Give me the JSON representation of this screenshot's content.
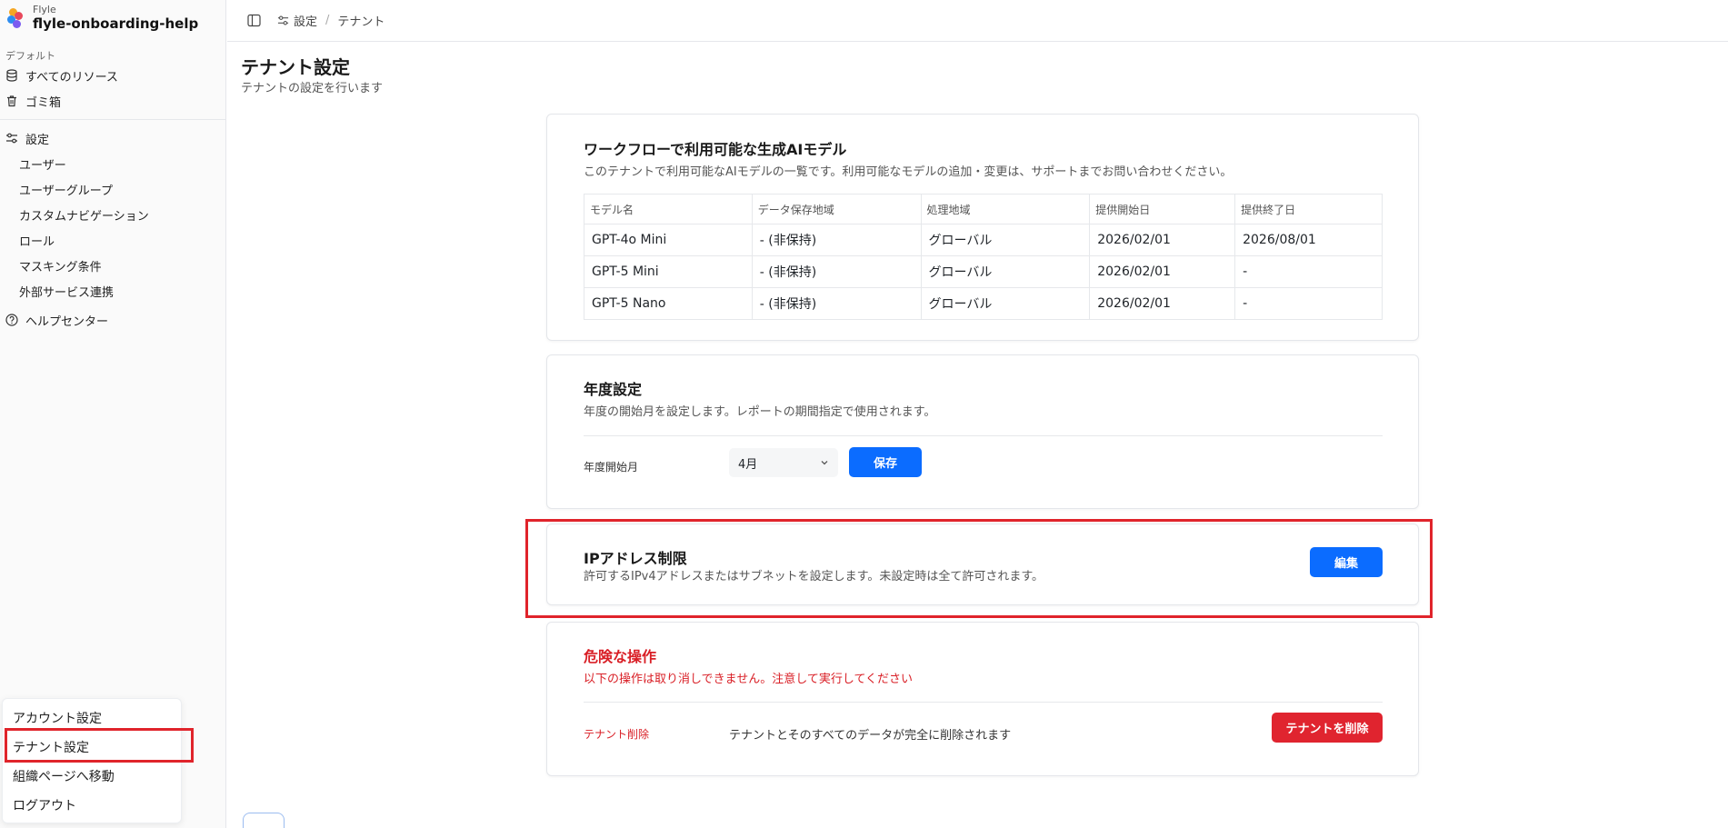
{
  "app": {
    "brand": "Flyle",
    "workspace": "flyle-onboarding-help"
  },
  "sidebar": {
    "section_label": "デフォルト",
    "items": [
      {
        "label": "すべてのリソース",
        "icon": "database-icon"
      },
      {
        "label": "ゴミ箱",
        "icon": "trash-icon"
      }
    ],
    "settings": {
      "label": "設定",
      "icon": "sliders-icon",
      "children": [
        "ユーザー",
        "ユーザーグループ",
        "カスタムナビゲーション",
        "ロール",
        "マスキング条件",
        "外部サービス連携"
      ]
    },
    "help": {
      "label": "ヘルプセンター",
      "icon": "help-circle-icon"
    }
  },
  "user_menu": {
    "items": [
      "アカウント設定",
      "テナント設定",
      "組織ページへ移動",
      "ログアウト"
    ]
  },
  "breadcrumb": {
    "settings": "設定",
    "separator": "/",
    "current": "テナント"
  },
  "page": {
    "title": "テナント設定",
    "subtitle": "テナントの設定を行います"
  },
  "ai_models": {
    "title": "ワークフローで利用可能な生成AIモデル",
    "description": "このテナントで利用可能なAIモデルの一覧です。利用可能なモデルの追加・変更は、サポートまでお問い合わせください。",
    "headers": [
      "モデル名",
      "データ保存地域",
      "処理地域",
      "提供開始日",
      "提供終了日"
    ],
    "rows": [
      [
        "GPT-4o Mini",
        "- (非保持)",
        "グローバル",
        "2026/02/01",
        "2026/08/01"
      ],
      [
        "GPT-5 Mini",
        "- (非保持)",
        "グローバル",
        "2026/02/01",
        "-"
      ],
      [
        "GPT-5 Nano",
        "- (非保持)",
        "グローバル",
        "2026/02/01",
        "-"
      ]
    ]
  },
  "fiscal_year": {
    "title": "年度設定",
    "description": "年度の開始月を設定します。レポートの期間指定で使用されます。",
    "field_label": "年度開始月",
    "selected_month": "4月",
    "save_label": "保存"
  },
  "ip_restriction": {
    "title": "IPアドレス制限",
    "description": "許可するIPv4アドレスまたはサブネットを設定します。未設定時は全て許可されます。",
    "edit_label": "編集"
  },
  "danger_zone": {
    "title": "危険な操作",
    "description": "以下の操作は取り消しできません。注意して実行してください",
    "action_label": "テナント削除",
    "action_description": "テナントとそのすべてのデータが完全に削除されます",
    "delete_label": "テナントを削除"
  },
  "colors": {
    "primary": "#0b6cff",
    "danger": "#e0242f",
    "highlight": "#e0242b"
  }
}
